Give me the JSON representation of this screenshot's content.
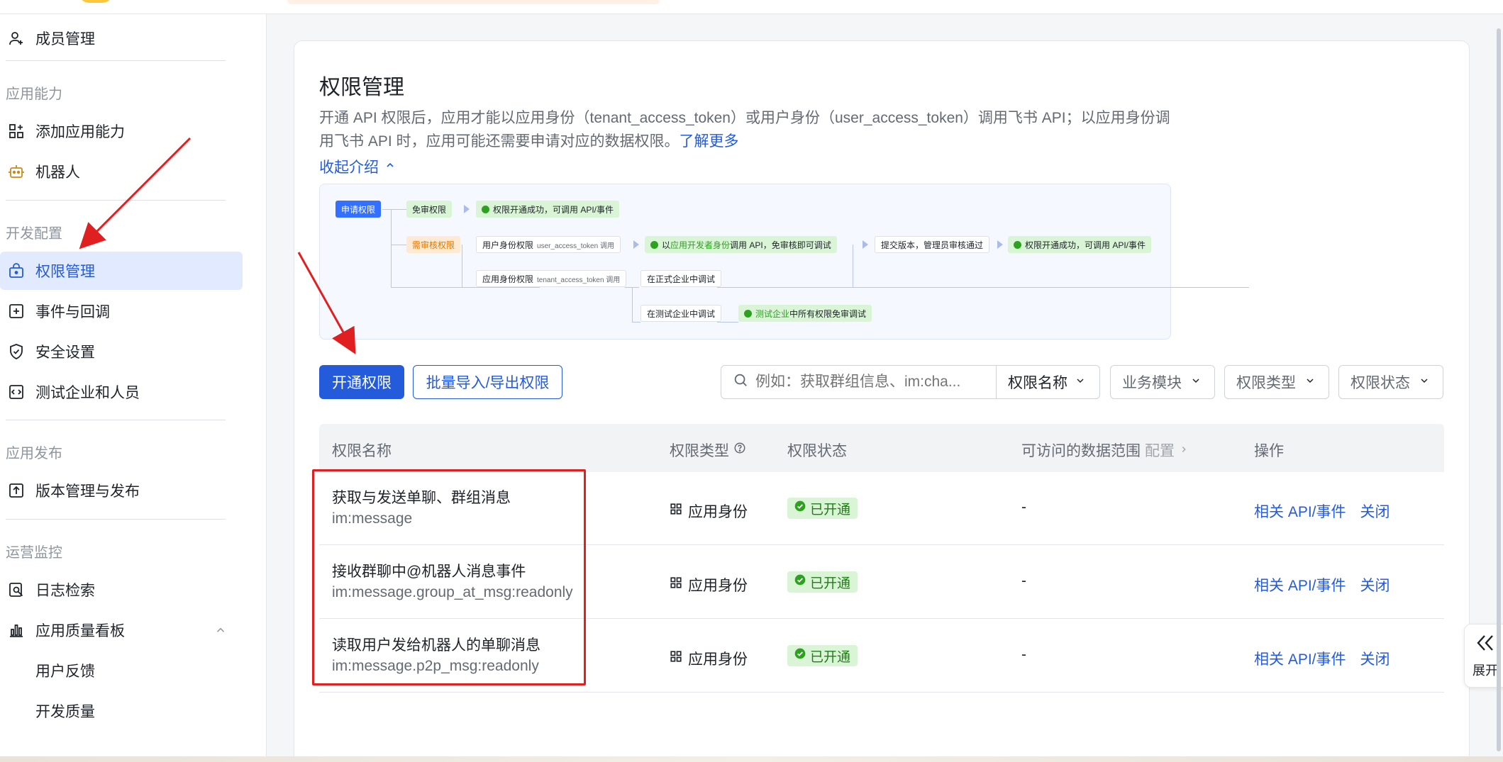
{
  "sidebar": {
    "members": "成员管理",
    "group_app_capability": "应用能力",
    "add_capability": "添加应用能力",
    "bot": "机器人",
    "group_dev_config": "开发配置",
    "permission_mgmt": "权限管理",
    "events_callbacks": "事件与回调",
    "security": "安全设置",
    "test_tenant": "测试企业和人员",
    "group_release": "应用发布",
    "version_release": "版本管理与发布",
    "group_ops": "运营监控",
    "log_search": "日志检索",
    "quality_board": "应用质量看板",
    "user_feedback": "用户反馈",
    "dev_quality": "开发质量"
  },
  "main": {
    "title": "权限管理",
    "intro_text": "开通 API 权限后，应用才能以应用身份（tenant_access_token）或用户身份（user_access_token）调用飞书 API；以应用身份调用飞书 API 时，应用可能还需要申请对应的数据权限。",
    "learn_more": "了解更多",
    "collapse_intro": "收起介绍"
  },
  "flow": {
    "apply": "申请权限",
    "no_review": "免审权限",
    "success1": "权限开通成功，可调用 API/事件",
    "need_review": "需审核权限",
    "user_identity": "用户身份权限",
    "user_token_call": "user_access_token 调用",
    "dev_test_prefix": "以",
    "dev_identity": "应用开发者身份",
    "dev_test_suffix": "调用 API，免审核即可调试",
    "submit_version": "提交版本，管理员审核通过",
    "success2": "权限开通成功，可调用 API/事件",
    "app_identity": "应用身份权限",
    "tenant_token_call": "tenant_access_token 调用",
    "debug_prod": "在正式企业中调试",
    "debug_test": "在测试企业中调试",
    "test_tenant": "测试企业",
    "test_tenant_suffix": "中所有权限免审调试"
  },
  "toolbar": {
    "enable_permission": "开通权限",
    "batch_import_export": "批量导入/导出权限",
    "search_placeholder": "例如：获取群组信息、im:cha...",
    "search_field": "权限名称",
    "filter_module": "业务模块",
    "filter_type": "权限类型",
    "filter_status": "权限状态"
  },
  "table": {
    "headers": {
      "name": "权限名称",
      "type": "权限类型",
      "status": "权限状态",
      "range": "可访问的数据范围",
      "range_config": "配置",
      "actions": "操作"
    },
    "rows": [
      {
        "name": "获取与发送单聊、群组消息",
        "code": "im:message",
        "type": "应用身份",
        "status": "已开通",
        "range": "-",
        "action_api": "相关 API/事件",
        "action_close": "关闭"
      },
      {
        "name": "接收群聊中@机器人消息事件",
        "code": "im:message.group_at_msg:readonly",
        "type": "应用身份",
        "status": "已开通",
        "range": "-",
        "action_api": "相关 API/事件",
        "action_close": "关闭"
      },
      {
        "name": "读取用户发给机器人的单聊消息",
        "code": "im:message.p2p_msg:readonly",
        "type": "应用身份",
        "status": "已开通",
        "range": "-",
        "action_api": "相关 API/事件",
        "action_close": "关闭"
      }
    ]
  },
  "expand_tab": {
    "label": "展开"
  },
  "colors": {
    "accent": "#245bdb",
    "active_bg": "#e1eaff",
    "status_green": "#2ea121",
    "annotation_red": "#e02020"
  },
  "icons": {
    "members": "user-add-icon",
    "add_capability": "grid-add-icon",
    "bot": "robot-icon",
    "permission": "lock-box-icon",
    "events": "plus-square-icon",
    "security": "shield-check-icon",
    "test_tenant": "code-window-icon",
    "version": "upload-box-icon",
    "log": "search-doc-icon",
    "quality": "bar-chart-icon",
    "search": "search-icon",
    "chevron": "chevron-down-icon",
    "question": "question-circle-icon",
    "app_identity": "grid-icon",
    "status_ok": "check-circle-icon",
    "expand": "double-chevron-left-icon"
  }
}
